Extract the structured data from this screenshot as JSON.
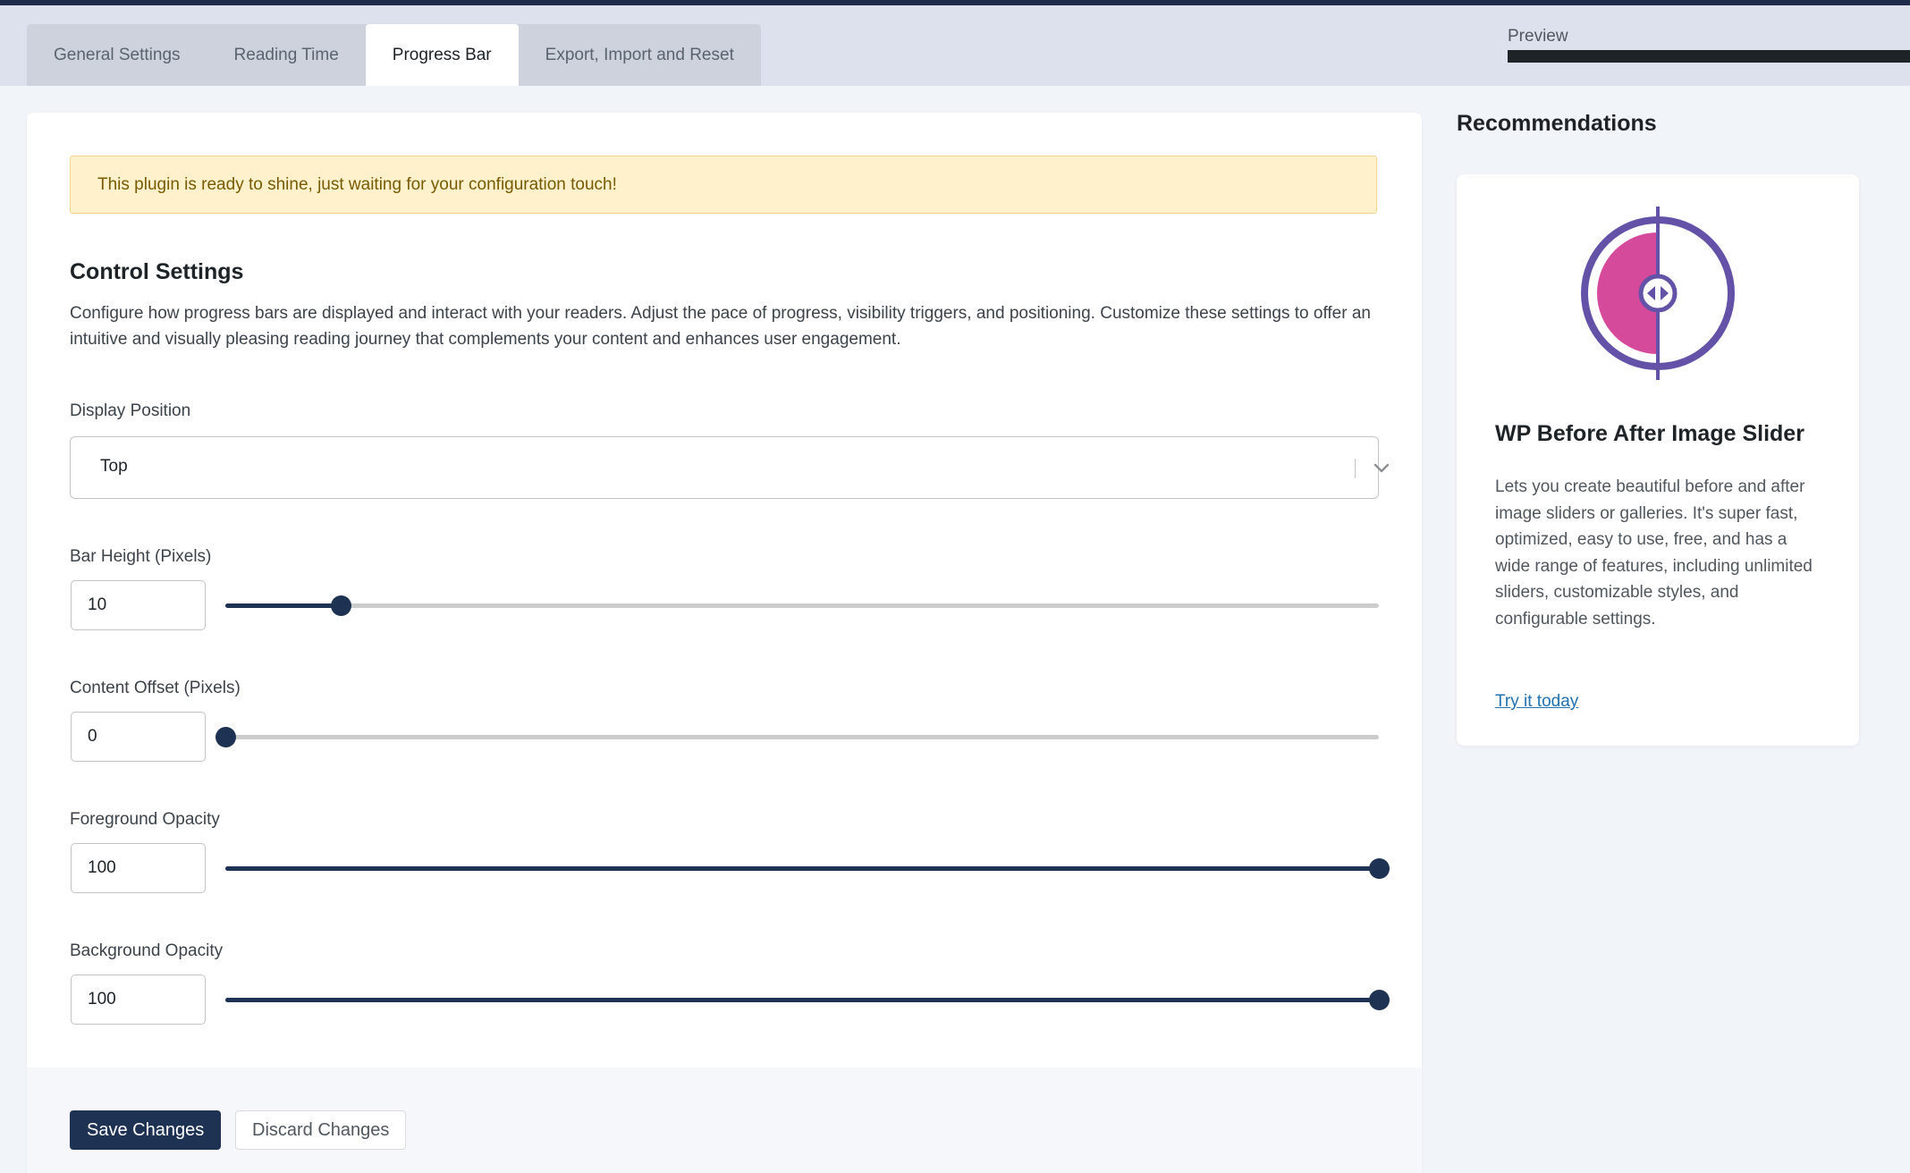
{
  "tabs": [
    {
      "label": "General Settings"
    },
    {
      "label": "Reading Time"
    },
    {
      "label": "Progress Bar",
      "active": true
    },
    {
      "label": "Export, Import and Reset"
    }
  ],
  "preview": {
    "label": "Preview"
  },
  "notice": "This plugin is ready to shine, just waiting for your configuration touch!",
  "control": {
    "title": "Control Settings",
    "description": "Configure how progress bars are displayed and interact with your readers. Adjust the pace of progress, visibility triggers, and positioning. Customize these settings to offer an intuitive and visually pleasing reading journey that complements your content and enhances user engagement."
  },
  "display_position": {
    "label": "Display Position",
    "value": "Top"
  },
  "fields": [
    {
      "label": "Bar Height (Pixels)",
      "value": "10",
      "slider_fraction": 0.1
    },
    {
      "label": "Content Offset (Pixels)",
      "value": "0",
      "slider_fraction": 0.0
    },
    {
      "label": "Foreground Opacity",
      "value": "100",
      "slider_fraction": 1.0
    },
    {
      "label": "Background Opacity",
      "value": "100",
      "slider_fraction": 1.0
    }
  ],
  "buttons": {
    "save": "Save Changes",
    "discard": "Discard Changes"
  },
  "recommendations": {
    "title": "Recommendations",
    "card": {
      "name": "WP Before After Image Slider",
      "description": "Lets you create beautiful before and after image sliders or galleries. It's super fast, optimized, easy to use, free, and has a wide range of features, including unlimited sliders, customizable styles, and configurable settings.",
      "link": "Try it today",
      "logo_icon": "before-after-slider-logo"
    }
  },
  "colors": {
    "accent": "#1e3254",
    "notice_bg": "#fef1cb",
    "link": "#2271b1",
    "logo_purple": "#6352a8",
    "logo_pink": "#d64a9b"
  }
}
